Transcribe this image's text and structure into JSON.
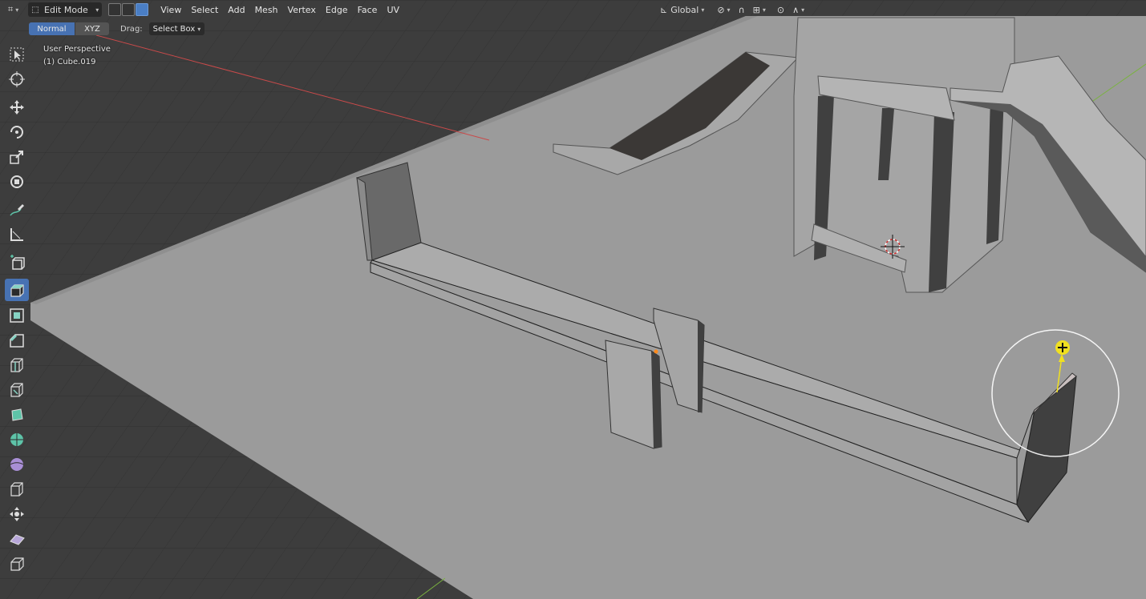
{
  "header": {
    "mode": "Edit Mode",
    "menus": [
      "View",
      "Select",
      "Add",
      "Mesh",
      "Vertex",
      "Edge",
      "Face",
      "UV"
    ],
    "transform_orientation": "Global"
  },
  "tool_settings": {
    "orientation_normal": "Normal",
    "orientation_xyz": "XYZ",
    "drag_label": "Drag:",
    "drag_value": "Select Box"
  },
  "viewport": {
    "view_name": "User Perspective",
    "object_name": "(1) Cube.019"
  },
  "toolbar": {
    "tools": [
      "select-box-icon",
      "cursor-icon",
      "move-icon",
      "rotate-icon",
      "scale-icon",
      "transform-icon",
      "annotate-icon",
      "measure-icon",
      "add-cube-icon",
      "extrude-region-icon",
      "inset-faces-icon",
      "bevel-icon",
      "loop-cut-icon",
      "knife-icon",
      "poly-build-icon",
      "spin-icon",
      "smooth-icon",
      "edge-slide-icon",
      "shrink-fatten-icon",
      "shear-icon",
      "rip-region-icon"
    ],
    "active_tool": "extrude-region-icon"
  },
  "colors": {
    "accent": "#4772b3",
    "background": "#3d3d3d",
    "floor_plane": "#9b9b9b",
    "x_axis": "#c94a4a",
    "y_axis": "#7ab33f",
    "gizmo_handle": "#f0e020"
  }
}
